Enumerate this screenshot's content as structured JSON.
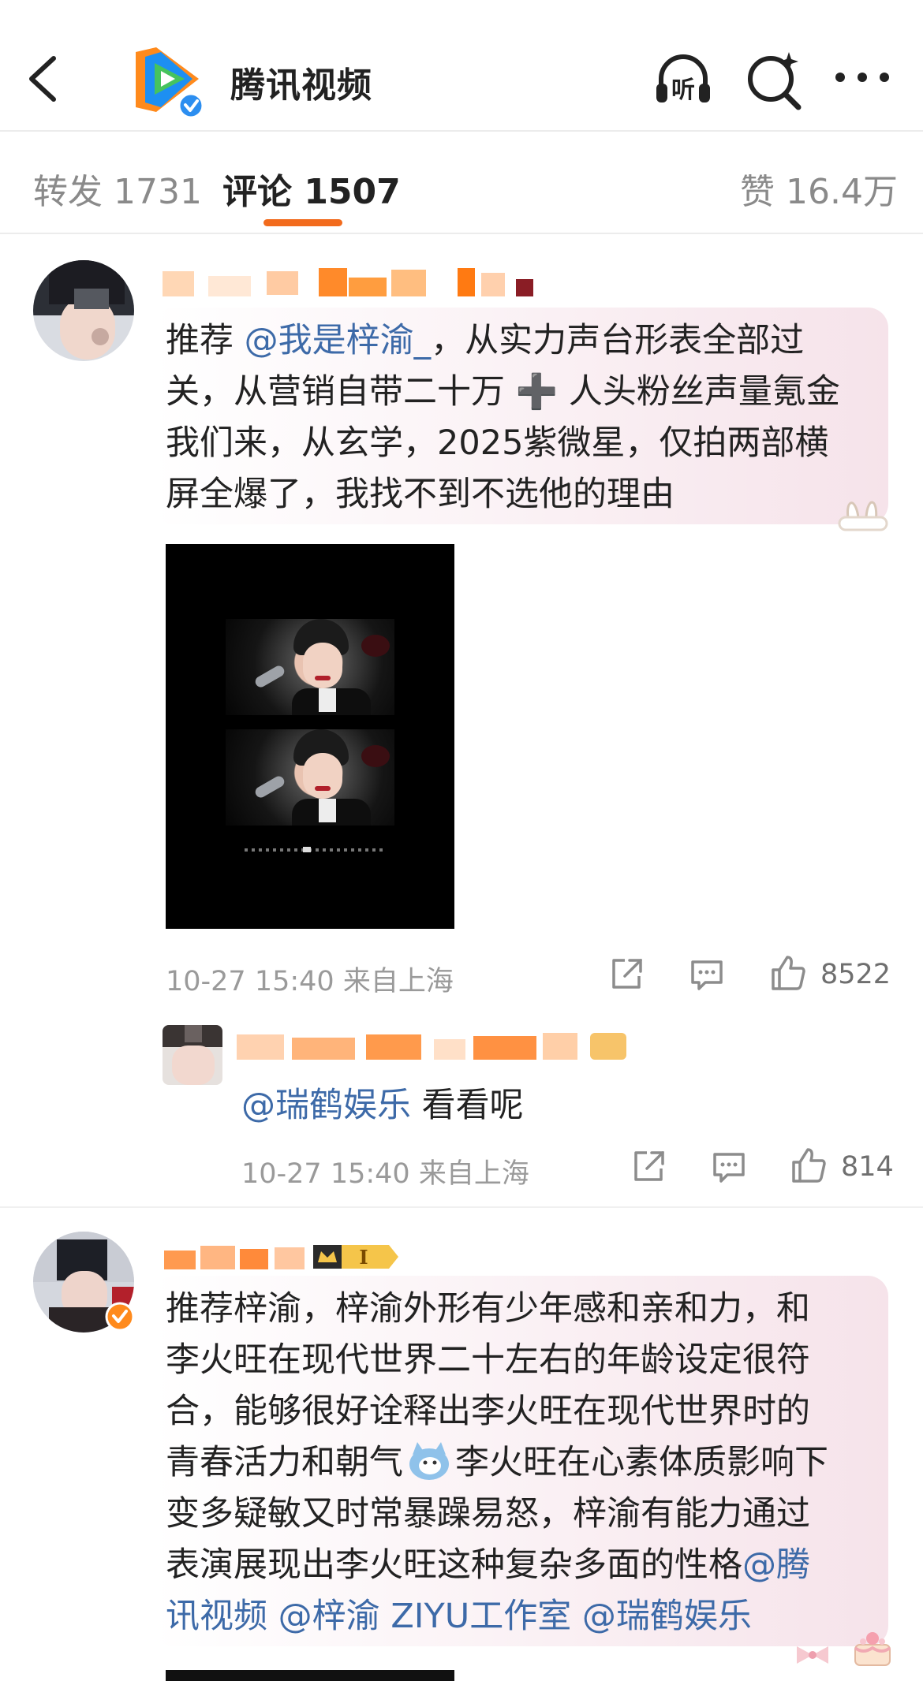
{
  "header": {
    "title": "腾讯视频",
    "icons": [
      "back-chevron-icon",
      "tencent-video-logo-icon",
      "listen-headphones-icon",
      "super-search-icon",
      "more-dots-icon"
    ],
    "listen_glyph": "听",
    "brand_colors": {
      "logo_green": "#46c35d",
      "logo_blue": "#1d8ff2",
      "logo_orange": "#ff8a1c",
      "verified_blue": "#2c8ef0"
    }
  },
  "tabs": {
    "repost_label": "转发 1731",
    "comment_label": "评论 1507",
    "like_label": "赞 16.4万",
    "active_color": "#f26b1d"
  },
  "comments": [
    {
      "text_lines": [
        {
          "prefix": "推荐 ",
          "mention": "@我是梓渝_",
          "suffix": "，从实力声台形表全部过"
        },
        {
          "text": "关，从营销自带二十万 ➕ 人头粉丝声量氪金"
        },
        {
          "text": "我们来，从玄学，2025紫微星，仅拍两部横"
        },
        {
          "text": "屏全爆了，我找不到不选他的理由"
        }
      ],
      "meta": "10-27 15:40  来自上海",
      "like_count": "8522",
      "reply": {
        "mention": "@瑞鹤娱乐",
        "text": " 看看呢",
        "meta": "10-27 15:40  来自上海",
        "like_count": "814"
      }
    },
    {
      "text_lines": [
        {
          "text": "推荐梓渝，梓渝外形有少年感和亲和力，和"
        },
        {
          "text": "李火旺在现代世界二十左右的年龄设定很符"
        },
        {
          "text": "合，能够很好诠释出李火旺在现代世界时的"
        },
        {
          "text": "青春活力和朝气",
          "after_sticker": "李火旺在心素体质影响下"
        },
        {
          "text": "变多疑敏又时常暴躁易怒，梓渝有能力通过"
        },
        {
          "text": "表演展现出李火旺这种复杂多面的性格",
          "mention": "@腾"
        },
        {
          "mention_full": "讯视频 @梓渝 ZIYU工作室 @瑞鹤娱乐"
        }
      ]
    }
  ]
}
